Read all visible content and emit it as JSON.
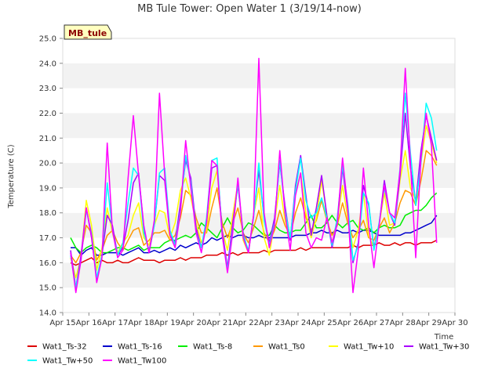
{
  "chart_data": {
    "type": "line",
    "title": "MB Tule Tower: Open Water 1 (3/19/14-now)",
    "xlabel": "Time",
    "ylabel": "Temperature (C)",
    "xlim": [
      15,
      30
    ],
    "ylim": [
      14.0,
      25.0
    ],
    "x_ticks": [
      15,
      16,
      17,
      18,
      19,
      20,
      21,
      22,
      23,
      24,
      25,
      26,
      27,
      28,
      29,
      30
    ],
    "x_tick_labels": [
      "Apr 15",
      "Apr 16",
      "Apr 17",
      "Apr 18",
      "Apr 19",
      "Apr 20",
      "Apr 21",
      "Apr 22",
      "Apr 23",
      "Apr 24",
      "Apr 25",
      "Apr 26",
      "Apr 27",
      "Apr 28",
      "Apr 29",
      "Apr 30"
    ],
    "y_ticks": [
      14,
      15,
      16,
      17,
      18,
      19,
      20,
      21,
      22,
      23,
      24,
      25
    ],
    "y_tick_labels": [
      "14.0",
      "15.0",
      "16.0",
      "17.0",
      "18.0",
      "19.0",
      "20.0",
      "21.0",
      "22.0",
      "23.0",
      "24.0",
      "25.0"
    ],
    "grid": "horizontal alternating bands",
    "legend_position": "bottom",
    "annotation": "MB_tule",
    "x": [
      15.3,
      15.5,
      15.7,
      15.9,
      16.1,
      16.3,
      16.5,
      16.7,
      16.9,
      17.1,
      17.3,
      17.5,
      17.7,
      17.9,
      18.1,
      18.3,
      18.5,
      18.7,
      18.9,
      19.1,
      19.3,
      19.5,
      19.7,
      19.9,
      20.1,
      20.3,
      20.5,
      20.7,
      20.9,
      21.1,
      21.3,
      21.5,
      21.7,
      21.9,
      22.1,
      22.3,
      22.5,
      22.7,
      22.9,
      23.1,
      23.3,
      23.5,
      23.7,
      23.9,
      24.1,
      24.3,
      24.5,
      24.7,
      24.9,
      25.1,
      25.3,
      25.5,
      25.7,
      25.9,
      26.1,
      26.3,
      26.5,
      26.7,
      26.9,
      27.1,
      27.3,
      27.5,
      27.7,
      27.9,
      28.1,
      28.3,
      28.5,
      28.7,
      28.9,
      29.1,
      29.3
    ],
    "series": [
      {
        "name": "Wat1_Ts-32",
        "color": "#dd0000",
        "values": [
          16.0,
          15.9,
          16.0,
          16.1,
          16.2,
          16.0,
          16.1,
          16.0,
          16.0,
          16.1,
          16.0,
          16.0,
          16.1,
          16.2,
          16.1,
          16.1,
          16.1,
          16.0,
          16.1,
          16.1,
          16.1,
          16.2,
          16.1,
          16.2,
          16.2,
          16.2,
          16.3,
          16.3,
          16.3,
          16.4,
          16.3,
          16.4,
          16.3,
          16.4,
          16.4,
          16.4,
          16.4,
          16.5,
          16.4,
          16.5,
          16.5,
          16.5,
          16.5,
          16.5,
          16.6,
          16.5,
          16.6,
          16.6,
          16.6,
          16.6,
          16.6,
          16.6,
          16.6,
          16.6,
          16.7,
          16.6,
          16.7,
          16.7,
          16.7,
          16.8,
          16.7,
          16.7,
          16.8,
          16.7,
          16.8,
          16.8,
          16.7,
          16.8,
          16.8,
          16.8,
          16.9
        ]
      },
      {
        "name": "Wat1_Ts-16",
        "color": "#0000cc",
        "values": [
          16.6,
          16.6,
          16.3,
          16.5,
          16.6,
          16.3,
          16.3,
          16.4,
          16.4,
          16.4,
          16.3,
          16.4,
          16.5,
          16.6,
          16.4,
          16.4,
          16.5,
          16.4,
          16.5,
          16.6,
          16.5,
          16.7,
          16.6,
          16.7,
          16.8,
          16.7,
          16.8,
          17.0,
          16.9,
          17.0,
          17.1,
          17.0,
          17.1,
          17.1,
          17.0,
          17.0,
          17.1,
          17.0,
          17.0,
          17.0,
          17.0,
          17.0,
          17.0,
          17.1,
          17.1,
          17.1,
          17.2,
          17.2,
          17.3,
          17.2,
          17.2,
          17.3,
          17.2,
          17.2,
          17.3,
          17.2,
          17.3,
          17.3,
          17.2,
          17.1,
          17.1,
          17.1,
          17.1,
          17.1,
          17.2,
          17.2,
          17.3,
          17.4,
          17.5,
          17.6,
          17.9
        ]
      },
      {
        "name": "Wat1_Ts-8",
        "color": "#00ee00",
        "values": [
          17.0,
          16.6,
          16.4,
          16.6,
          16.7,
          16.6,
          16.4,
          16.4,
          16.5,
          16.6,
          16.6,
          16.5,
          16.6,
          16.7,
          16.5,
          16.6,
          16.6,
          16.6,
          16.8,
          16.9,
          16.9,
          17.0,
          17.1,
          17.0,
          17.2,
          17.6,
          17.4,
          17.2,
          17.0,
          17.4,
          17.8,
          17.4,
          17.2,
          17.3,
          17.6,
          17.5,
          17.3,
          17.1,
          17.1,
          17.5,
          17.3,
          17.2,
          17.2,
          17.3,
          17.3,
          17.6,
          17.9,
          17.4,
          17.4,
          17.6,
          17.9,
          17.6,
          17.4,
          17.6,
          17.7,
          17.4,
          17.3,
          17.4,
          17.2,
          17.4,
          17.5,
          17.4,
          17.4,
          17.5,
          17.9,
          18.0,
          18.1,
          18.1,
          18.3,
          18.6,
          18.8
        ]
      },
      {
        "name": "Wat1_Ts0",
        "color": "#ff9900",
        "values": [
          16.3,
          16.0,
          16.4,
          17.5,
          17.2,
          16.1,
          16.5,
          17.1,
          17.3,
          16.8,
          16.5,
          16.9,
          17.3,
          17.4,
          16.7,
          16.9,
          17.2,
          17.2,
          17.3,
          16.9,
          17.1,
          17.8,
          18.9,
          18.7,
          17.8,
          17.2,
          17.2,
          18.2,
          19.0,
          17.6,
          17.0,
          17.6,
          18.2,
          17.2,
          16.8,
          17.4,
          18.1,
          17.2,
          16.8,
          17.3,
          18.1,
          17.5,
          17.1,
          18.0,
          18.6,
          17.8,
          17.3,
          17.7,
          18.5,
          17.7,
          17.1,
          17.5,
          18.4,
          17.6,
          17.0,
          17.3,
          17.7,
          17.0,
          16.9,
          17.4,
          17.8,
          17.2,
          17.6,
          18.4,
          18.9,
          18.8,
          18.3,
          19.3,
          20.5,
          20.3,
          19.9
        ]
      },
      {
        "name": "Wat1_Tw+10",
        "color": "#ffff00",
        "values": [
          16.2,
          15.4,
          16.2,
          18.5,
          17.5,
          15.7,
          16.6,
          18.2,
          17.2,
          16.4,
          16.8,
          17.1,
          17.9,
          18.4,
          17.0,
          16.7,
          17.5,
          18.1,
          18.0,
          17.0,
          17.6,
          18.9,
          19.4,
          18.6,
          17.6,
          16.8,
          17.3,
          19.0,
          19.7,
          17.3,
          16.5,
          17.9,
          19.2,
          16.9,
          16.4,
          17.9,
          19.0,
          17.0,
          16.3,
          17.6,
          19.1,
          17.7,
          17.0,
          18.8,
          19.6,
          18.0,
          17.0,
          17.8,
          19.3,
          17.9,
          16.8,
          17.7,
          19.1,
          17.8,
          16.6,
          17.3,
          18.8,
          17.1,
          16.6,
          17.5,
          18.8,
          17.5,
          17.6,
          19.3,
          20.5,
          19.0,
          18.5,
          20.0,
          21.5,
          20.8,
          20.0
        ]
      },
      {
        "name": "Wat1_Tw+30",
        "color": "#aa00ff",
        "values": [
          16.5,
          15.0,
          16.3,
          18.2,
          17.0,
          15.3,
          16.3,
          17.9,
          17.5,
          16.3,
          16.6,
          17.7,
          19.2,
          19.6,
          17.4,
          16.4,
          17.5,
          19.5,
          19.3,
          17.1,
          16.8,
          18.4,
          20.1,
          19.4,
          17.4,
          16.6,
          17.6,
          19.8,
          19.9,
          17.3,
          15.8,
          17.6,
          19.1,
          17.2,
          16.4,
          17.9,
          19.7,
          17.8,
          16.8,
          17.8,
          20.0,
          18.3,
          16.9,
          19.1,
          20.3,
          18.7,
          17.1,
          18.2,
          19.5,
          17.9,
          16.6,
          17.6,
          19.8,
          18.1,
          16.0,
          16.8,
          19.1,
          18.3,
          16.6,
          17.5,
          19.3,
          18.0,
          17.5,
          19.5,
          22.0,
          19.8,
          18.4,
          20.5,
          21.9,
          21.0,
          20.1
        ]
      },
      {
        "name": "Wat1_Tw+50",
        "color": "#00ffff",
        "values": [
          16.3,
          15.0,
          16.1,
          18.1,
          17.2,
          15.4,
          16.3,
          19.2,
          17.3,
          16.3,
          16.8,
          18.4,
          19.8,
          19.5,
          17.2,
          16.5,
          17.5,
          19.6,
          19.8,
          17.3,
          16.7,
          18.1,
          20.3,
          19.2,
          17.2,
          16.6,
          17.8,
          20.1,
          20.2,
          17.1,
          15.7,
          17.3,
          19.2,
          17.1,
          16.5,
          17.8,
          20.0,
          17.7,
          16.7,
          17.6,
          20.1,
          18.1,
          17.0,
          18.9,
          20.2,
          18.5,
          17.8,
          18.0,
          18.6,
          17.8,
          16.7,
          17.8,
          19.9,
          18.4,
          16.1,
          16.7,
          18.8,
          18.4,
          16.5,
          17.6,
          19.0,
          18.0,
          17.6,
          19.8,
          22.8,
          20.4,
          18.3,
          20.0,
          22.4,
          21.8,
          20.5
        ]
      },
      {
        "name": "Wat1_Tw100",
        "color": "#ff00ff",
        "values": [
          16.4,
          14.8,
          16.1,
          18.2,
          17.1,
          15.2,
          16.2,
          20.8,
          17.3,
          16.2,
          16.5,
          19.4,
          21.9,
          19.5,
          17.5,
          16.4,
          17.7,
          22.8,
          19.5,
          17.1,
          16.6,
          18.0,
          20.9,
          19.0,
          17.2,
          16.4,
          17.6,
          20.1,
          19.9,
          17.1,
          15.6,
          17.2,
          19.4,
          17.0,
          16.4,
          17.9,
          24.2,
          18.0,
          16.6,
          17.5,
          20.5,
          18.0,
          16.5,
          18.7,
          19.6,
          17.2,
          16.6,
          17.0,
          16.9,
          17.8,
          16.8,
          17.6,
          20.2,
          18.2,
          14.8,
          16.5,
          19.8,
          17.5,
          15.8,
          17.5,
          19.1,
          18.0,
          17.8,
          19.7,
          23.8,
          20.0,
          16.2,
          20.2,
          22.0,
          20.7,
          16.8
        ]
      }
    ]
  }
}
